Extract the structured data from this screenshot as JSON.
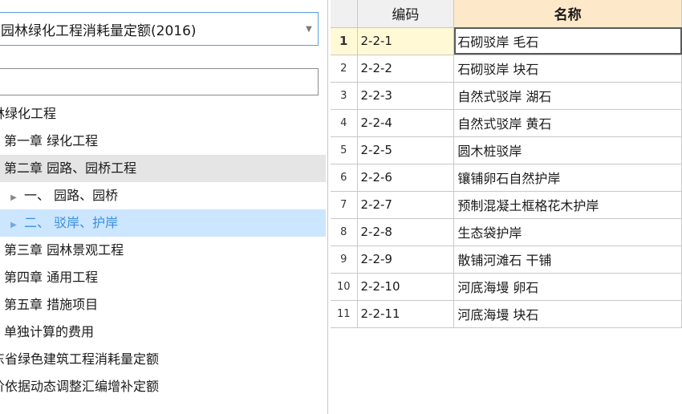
{
  "quota_select": {
    "value": "园林绿化工程消耗量定额(2016)"
  },
  "search": {
    "value": ""
  },
  "tree": [
    {
      "label": "林绿化工程",
      "level": 0,
      "state": "none"
    },
    {
      "label": "第一章 绿化工程",
      "level": 1,
      "state": "none"
    },
    {
      "label": "第二章 园路、园桥工程",
      "level": 1,
      "state": "gray"
    },
    {
      "label": "一、  园路、园桥",
      "level": 2,
      "state": "none",
      "collapsible": true
    },
    {
      "label": "二、  驳岸、护岸",
      "level": 2,
      "state": "blue",
      "collapsible": true
    },
    {
      "label": "第三章 园林景观工程",
      "level": 1,
      "state": "none"
    },
    {
      "label": "第四章 通用工程",
      "level": 1,
      "state": "none"
    },
    {
      "label": "第五章 措施项目",
      "level": 1,
      "state": "none"
    },
    {
      "label": "单独计算的费用",
      "level": 1,
      "state": "none"
    },
    {
      "label": "东省绿色建筑工程消耗量定额",
      "level": 0,
      "state": "none"
    },
    {
      "label": "价依据动态调整汇编增补定额",
      "level": 0,
      "state": "none"
    }
  ],
  "grid": {
    "headers": {
      "code": "编码",
      "name": "名称"
    },
    "rows": [
      {
        "idx": "1",
        "code": "2-2-1",
        "name": "石砌驳岸 毛石"
      },
      {
        "idx": "2",
        "code": "2-2-2",
        "name": "石砌驳岸 块石"
      },
      {
        "idx": "3",
        "code": "2-2-3",
        "name": "自然式驳岸 湖石"
      },
      {
        "idx": "4",
        "code": "2-2-4",
        "name": "自然式驳岸 黄石"
      },
      {
        "idx": "5",
        "code": "2-2-5",
        "name": "圆木桩驳岸"
      },
      {
        "idx": "6",
        "code": "2-2-6",
        "name": "镶铺卵石自然护岸"
      },
      {
        "idx": "7",
        "code": "2-2-7",
        "name": "预制混凝土框格花木护岸"
      },
      {
        "idx": "8",
        "code": "2-2-8",
        "name": "生态袋护岸"
      },
      {
        "idx": "9",
        "code": "2-2-9",
        "name": "散铺河滩石 干铺"
      },
      {
        "idx": "10",
        "code": "2-2-10",
        "name": "河底海墁 卵石"
      },
      {
        "idx": "11",
        "code": "2-2-11",
        "name": "河底海墁 块石"
      }
    ]
  }
}
